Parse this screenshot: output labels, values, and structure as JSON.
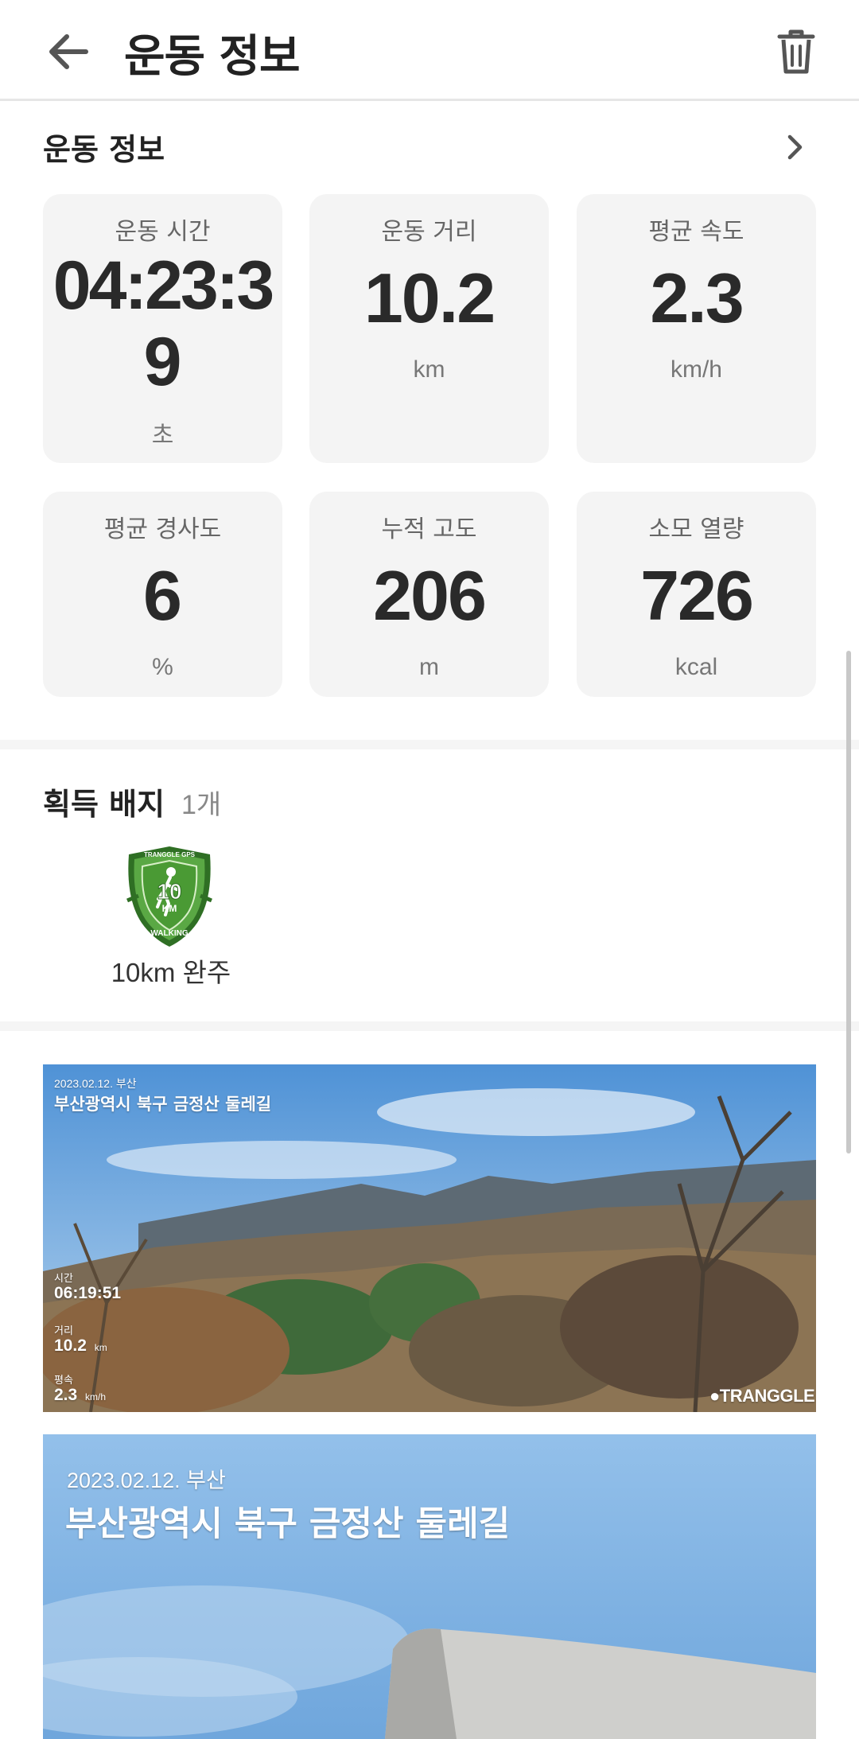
{
  "header": {
    "title": "운동 정보",
    "back_icon": "arrow-left-icon",
    "delete_icon": "trash-icon"
  },
  "section": {
    "title": "운동 정보",
    "more_icon": "chevron-right-icon"
  },
  "stats": [
    {
      "label": "운동 시간",
      "value_line1": "04:23:3",
      "value_line2": "9",
      "unit": "초"
    },
    {
      "label": "운동 거리",
      "value": "10.2",
      "unit": "km"
    },
    {
      "label": "평균 속도",
      "value": "2.3",
      "unit": "km/h"
    },
    {
      "label": "평균 경사도",
      "value": "6",
      "unit": "%"
    },
    {
      "label": "누적 고도",
      "value": "206",
      "unit": "m"
    },
    {
      "label": "소모 열량",
      "value": "726",
      "unit": "kcal"
    }
  ],
  "badges": {
    "title": "획득 배지",
    "count": "1개",
    "items": [
      {
        "label": "10km 완주",
        "icon": "10km-walking-badge-icon",
        "art_text": {
          "top": "TRANGGLE GPS",
          "number": "10",
          "unit": "KM",
          "bottom": "WALKING"
        }
      }
    ]
  },
  "photos": [
    {
      "date": "2023.02.12. 부산",
      "place": "부산광역시 북구 금정산 둘레길",
      "time_label": "시간",
      "time_value": "06:19:51",
      "distance_label": "거리",
      "distance_value": "10.2",
      "distance_unit": "km",
      "speed_label": "평속",
      "speed_value": "2.3",
      "speed_unit": "km/h",
      "brand": "TRANGGLE"
    },
    {
      "date": "2023.02.12. 부산",
      "place": "부산광역시 북구 금정산 둘레길"
    }
  ],
  "colors": {
    "card_bg": "#f4f4f4",
    "badge_green": "#4a9a34",
    "sky": "#8ab8e4"
  }
}
